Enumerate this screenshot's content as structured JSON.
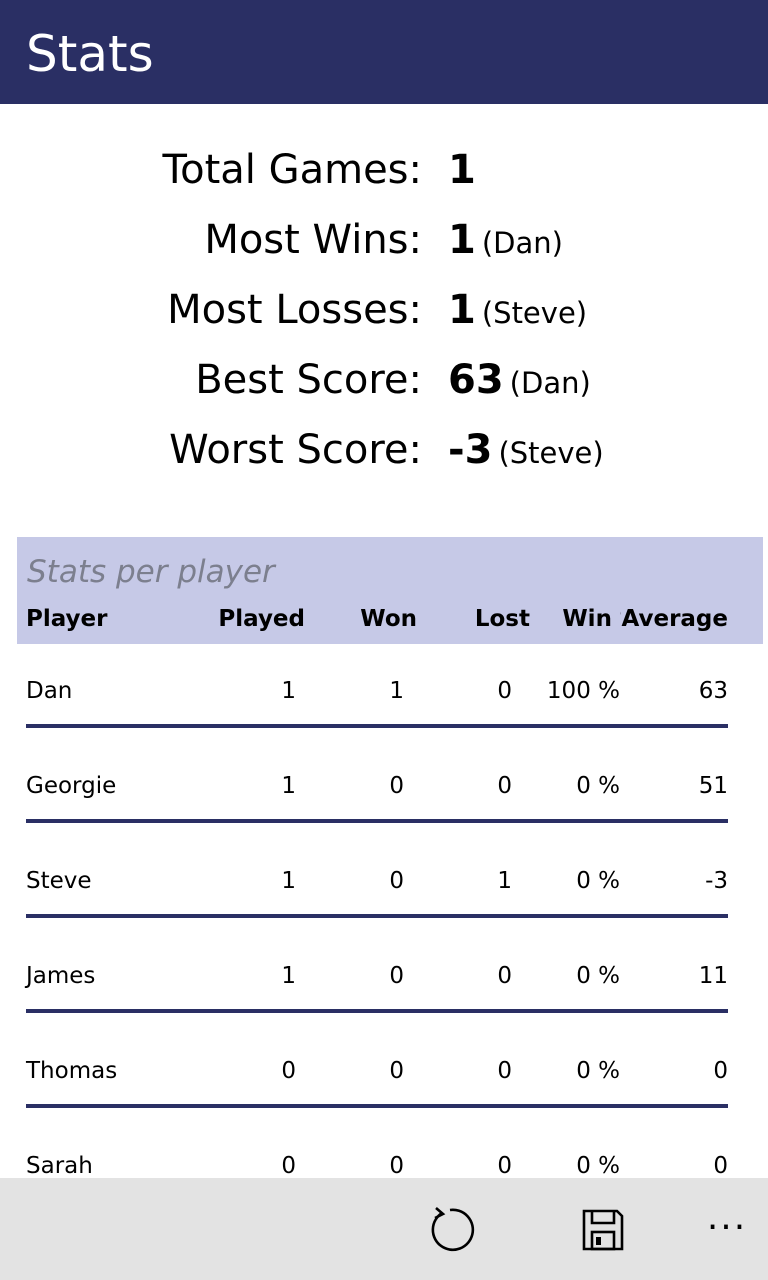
{
  "header": {
    "title": "Stats"
  },
  "summary": [
    {
      "label": "Total Games:",
      "value": "1",
      "who": ""
    },
    {
      "label": "Most Wins:",
      "value": "1",
      "who": "(Dan)"
    },
    {
      "label": "Most Losses:",
      "value": "1",
      "who": "(Steve)"
    },
    {
      "label": "Best Score:",
      "value": "63",
      "who": "(Dan)"
    },
    {
      "label": "Worst Score:",
      "value": "-3",
      "who": "(Steve)"
    }
  ],
  "table": {
    "caption": "Stats per player",
    "columns": [
      "Player",
      "Played",
      "Won",
      "Lost",
      "Win %",
      "Average"
    ],
    "rows": [
      {
        "player": "Dan",
        "played": "1",
        "won": "1",
        "lost": "0",
        "win_pct": "100 %",
        "average": "63"
      },
      {
        "player": "Georgie",
        "played": "1",
        "won": "0",
        "lost": "0",
        "win_pct": "0 %",
        "average": "51"
      },
      {
        "player": "Steve",
        "played": "1",
        "won": "0",
        "lost": "1",
        "win_pct": "0 %",
        "average": "-3"
      },
      {
        "player": "James",
        "played": "1",
        "won": "0",
        "lost": "0",
        "win_pct": "0 %",
        "average": "11"
      },
      {
        "player": "Thomas",
        "played": "0",
        "won": "0",
        "lost": "0",
        "win_pct": "0 %",
        "average": "0"
      },
      {
        "player": "Sarah",
        "played": "0",
        "won": "0",
        "lost": "0",
        "win_pct": "0 %",
        "average": "0"
      }
    ]
  },
  "app_bar": {
    "icons": [
      "refresh-icon",
      "save-icon"
    ],
    "more": "..."
  },
  "colors": {
    "header_bg": "#2a2f64",
    "table_header_bg": "#c6c9e7",
    "divider": "#2a2f64",
    "app_bar_bg": "#e3e3e3"
  }
}
